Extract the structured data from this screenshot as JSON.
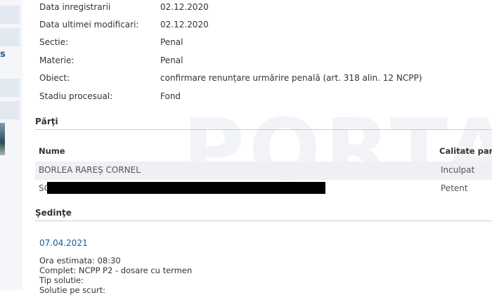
{
  "details": [
    {
      "label": "Data inregistrarii",
      "value": "02.12.2020"
    },
    {
      "label": "Data ultimei modificari:",
      "value": "02.12.2020"
    },
    {
      "label": "Sectie:",
      "value": "Penal"
    },
    {
      "label": "Materie:",
      "value": "Penal"
    },
    {
      "label": "Obiect:",
      "value": "confirmare renunțare urmărire penală (art. 318 alin. 12 NCPP)"
    },
    {
      "label": "Stadiu procesual:",
      "value": "Fond"
    }
  ],
  "sections": {
    "parti_title": "Părţi",
    "sedinte_title": "Şedinţe"
  },
  "parties_table": {
    "columns": [
      "Nume",
      "Calitate parte"
    ],
    "rows": [
      {
        "name": "BORLEA RAREȘ CORNEL",
        "role": "Inculpat"
      },
      {
        "name": "SC",
        "role": "Petent"
      }
    ]
  },
  "hearing": {
    "date": "07.04.2021",
    "ora": "Ora estimata: 08:30",
    "complet": "Complet: NCPP P2 - dosare cu termen",
    "tip_solutie": "Tip solutie:",
    "solutie": "Solutie pe scurt:"
  },
  "left_gutter": {
    "glyph": "s"
  },
  "watermark": {
    "text": "PORTAL"
  },
  "colors": {
    "link": "#1e5a8c",
    "row_alt": "#eef0f3",
    "rule": "#c9ced5"
  }
}
